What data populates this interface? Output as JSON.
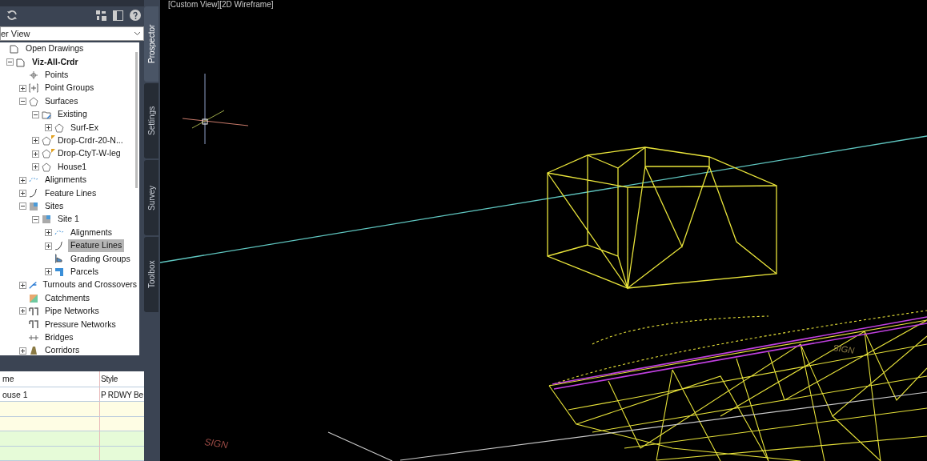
{
  "panel": {
    "view_selector": {
      "value": "er View"
    },
    "tree": [
      {
        "label": "Open Drawings",
        "kind": "drawings",
        "children": [
          {
            "label": "Viz-All-Crdr",
            "kind": "drawing",
            "bold": true,
            "expanded": true,
            "children": [
              {
                "label": "Points",
                "kind": "points"
              },
              {
                "label": "Point Groups",
                "kind": "point-groups",
                "expanded": false
              },
              {
                "label": "Surfaces",
                "kind": "surface",
                "expanded": true,
                "children": [
                  {
                    "label": "Existing",
                    "kind": "folder",
                    "expanded": true,
                    "flagged": false,
                    "children": [
                      {
                        "label": "Surf-Ex",
                        "kind": "surface",
                        "expanded": false
                      }
                    ]
                  },
                  {
                    "label": "Drop-Crdr-20-N...",
                    "kind": "surface",
                    "expanded": false,
                    "flagged": true
                  },
                  {
                    "label": "Drop-CtyT-W-leg",
                    "kind": "surface",
                    "expanded": false,
                    "flagged": true
                  },
                  {
                    "label": "House1",
                    "kind": "surface",
                    "expanded": false,
                    "flagged": false
                  }
                ]
              },
              {
                "label": "Alignments",
                "kind": "alignment",
                "expanded": false
              },
              {
                "label": "Feature Lines",
                "kind": "feature-line",
                "expanded": false
              },
              {
                "label": "Sites",
                "kind": "site",
                "expanded": true,
                "children": [
                  {
                    "label": "Site 1",
                    "kind": "site",
                    "expanded": true,
                    "children": [
                      {
                        "label": "Alignments",
                        "kind": "alignment",
                        "expanded": false,
                        "selected": false
                      },
                      {
                        "label": "Feature Lines",
                        "kind": "feature-line",
                        "expanded": false,
                        "selected": true
                      },
                      {
                        "label": "Grading Groups",
                        "kind": "grading",
                        "selected": false
                      },
                      {
                        "label": "Parcels",
                        "kind": "parcel",
                        "expanded": false,
                        "selected": false
                      }
                    ]
                  }
                ]
              },
              {
                "label": "Turnouts and Crossovers",
                "kind": "turnout",
                "expanded": false
              },
              {
                "label": "Catchments",
                "kind": "catchment"
              },
              {
                "label": "Pipe Networks",
                "kind": "pipe",
                "expanded": false
              },
              {
                "label": "Pressure Networks",
                "kind": "pipe"
              },
              {
                "label": "Bridges",
                "kind": "bridge"
              },
              {
                "label": "Corridors",
                "kind": "corridor",
                "expanded": false
              }
            ]
          }
        ]
      }
    ],
    "table": {
      "columns": [
        "me",
        "Style"
      ],
      "rows": [
        {
          "cells": [
            "ouse 1",
            "P RDWY Be"
          ],
          "color": "#ffffff"
        },
        {
          "color": "#fefde4"
        },
        {
          "color": "#fefde4"
        },
        {
          "color": "#e6fbd8"
        },
        {
          "color": "#e6fbd8"
        }
      ]
    }
  },
  "side_tabs": [
    {
      "label": "Prospector",
      "selected": true
    },
    {
      "label": "Settings",
      "selected": false
    },
    {
      "label": "Survey",
      "selected": false
    },
    {
      "label": "Toolbox",
      "selected": false
    }
  ],
  "viewport": {
    "label": "[Custom View][2D Wireframe]",
    "annotations": [
      "SIGN",
      "SIGN"
    ]
  }
}
